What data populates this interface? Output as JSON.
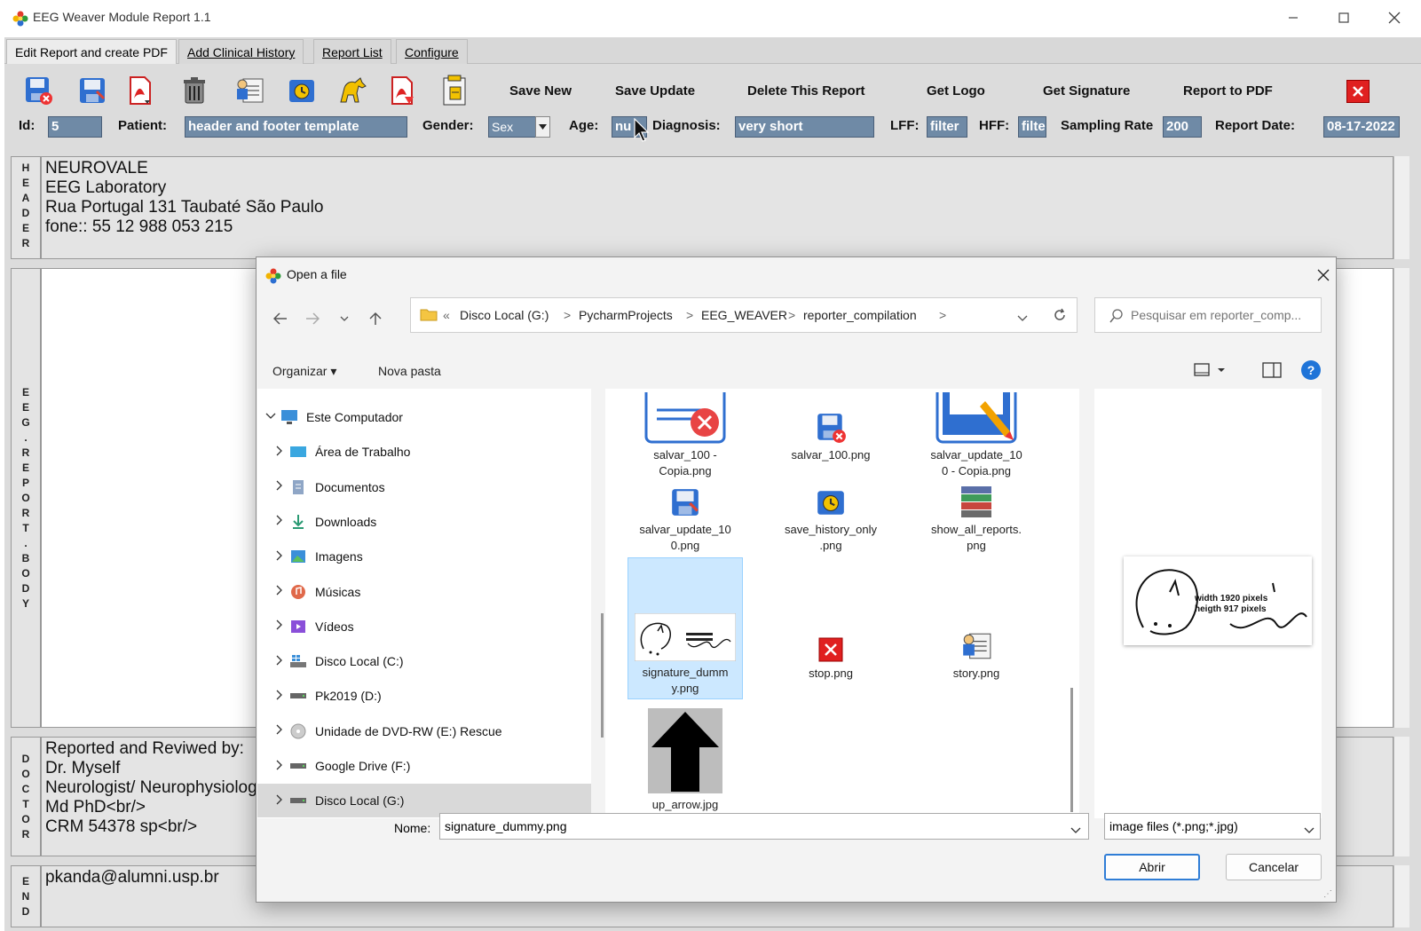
{
  "app": {
    "title": "EEG Weaver Module Report 1.1",
    "icon": "colorful-flower-icon"
  },
  "menu_tabs": [
    {
      "label": "Edit Report and create PDF",
      "active": true
    },
    {
      "label": "Add Clinical History",
      "active": false
    },
    {
      "label": "Report List",
      "active": false
    },
    {
      "label": "Configure",
      "active": false
    }
  ],
  "toolbar": {
    "icons": [
      "delete-save-icon",
      "save-icon",
      "pdf-icon",
      "trash-icon",
      "story-icon",
      "save-history-icon",
      "horse-logo-icon",
      "pdf-arrow-icon",
      "signature-file-icon"
    ],
    "labels": {
      "save_new": "Save New",
      "save_update": "Save Update",
      "delete_report": "Delete This Report",
      "get_logo": "Get Logo",
      "get_signature": "Get Signature",
      "report_to_pdf": "Report to PDF"
    }
  },
  "form": {
    "id_label": "Id:",
    "id_value": "5",
    "patient_label": "Patient:",
    "patient_value": "header and footer template",
    "gender_label": "Gender:",
    "gender_value": "Sex",
    "age_label": "Age:",
    "age_value": "nu",
    "diagnosis_label": "Diagnosis:",
    "diagnosis_value": "very short",
    "lff_label": "LFF:",
    "lff_value": "filter",
    "hff_label": "HFF:",
    "hff_value": "filte",
    "sampling_label": "Sampling Rate",
    "sampling_value": "200",
    "date_label": "Report Date:",
    "date_value": "08-17-2022"
  },
  "sections": {
    "header_letters": [
      "H",
      "E",
      "A",
      "D",
      "E",
      "R"
    ],
    "header_text": [
      "NEUROVALE",
      "EEG Laboratory",
      "Rua Portugal 131 Taubaté São Paulo",
      "fone::  55 12 988 053 215"
    ],
    "body_letters": [
      "E",
      "E",
      "G",
      ".",
      "R",
      "E",
      "P",
      "O",
      "R",
      "T",
      ".",
      "B",
      "O",
      "D",
      "Y"
    ],
    "doctor_letters": [
      "D",
      "O",
      "C",
      "T",
      "O",
      "R"
    ],
    "doctor_text": [
      "Reported and Reviwed by:",
      "Dr.  Myself",
      "Neurologist/ Neurophysiolog",
      "Md PhD<br/>",
      "CRM 54378 sp<br/>"
    ],
    "end_letters": [
      "E",
      "N",
      "D"
    ],
    "end_text": "pkanda@alumni.usp.br"
  },
  "dialog": {
    "title": "Open a file",
    "breadcrumb": [
      "«",
      "Disco Local (G:)",
      ">",
      "PycharmProjects",
      ">",
      "EEG_WEAVER",
      ">",
      "reporter_compilation",
      ">"
    ],
    "search_placeholder": "Pesquisar em reporter_comp...",
    "organize": "Organizar ▾",
    "new_folder": "Nova pasta",
    "tree": [
      {
        "label": "Este Computador",
        "icon": "computer-icon",
        "expanded": true,
        "indent": 0
      },
      {
        "label": "Área de Trabalho",
        "icon": "desktop-icon",
        "indent": 1
      },
      {
        "label": "Documentos",
        "icon": "documents-icon",
        "indent": 1
      },
      {
        "label": "Downloads",
        "icon": "download-icon",
        "indent": 1
      },
      {
        "label": "Imagens",
        "icon": "pictures-icon",
        "indent": 1
      },
      {
        "label": "Músicas",
        "icon": "music-icon",
        "indent": 1
      },
      {
        "label": "Vídeos",
        "icon": "videos-icon",
        "indent": 1
      },
      {
        "label": "Disco Local (C:)",
        "icon": "windows-drive-icon",
        "indent": 1
      },
      {
        "label": "Pk2019 (D:)",
        "icon": "drive-icon",
        "indent": 1
      },
      {
        "label": "Unidade de DVD-RW (E:) Rescue",
        "icon": "dvd-icon",
        "indent": 1
      },
      {
        "label": "Google Drive (F:)",
        "icon": "drive-icon",
        "indent": 1
      },
      {
        "label": "Disco Local (G:)",
        "icon": "drive-icon",
        "indent": 1,
        "selected": true
      }
    ],
    "files": [
      {
        "name": "salvar_100 - Copia.png",
        "lines": [
          "salvar_100 -",
          "Copia.png"
        ],
        "icon": "delete-save-icon"
      },
      {
        "name": "salvar_100.png",
        "lines": [
          "salvar_100.png"
        ],
        "icon": "delete-save-icon"
      },
      {
        "name": "salvar_update_100 - Copia.png",
        "lines": [
          "salvar_update_10",
          "0 - Copia.png"
        ],
        "icon": "edit-icon"
      },
      {
        "name": "salvar_update_100.png",
        "lines": [
          "salvar_update_10",
          "0.png"
        ],
        "icon": "save-icon"
      },
      {
        "name": "save_history_only.png",
        "lines": [
          "save_history_only",
          ".png"
        ],
        "icon": "save-history-icon"
      },
      {
        "name": "show_all_reports.png",
        "lines": [
          "show_all_reports.",
          "png"
        ],
        "icon": "stack-icon"
      },
      {
        "name": "signature_dummy.png",
        "lines": [
          "signature_dumm",
          "y.png"
        ],
        "icon": "signature-thumbnail-icon",
        "selected": true
      },
      {
        "name": "stop.png",
        "lines": [
          "stop.png"
        ],
        "icon": "stop-icon"
      },
      {
        "name": "story.png",
        "lines": [
          "story.png"
        ],
        "icon": "story-icon"
      },
      {
        "name": "up_arrow.jpg",
        "lines": [
          "up_arrow.jpg"
        ],
        "icon": "up-arrow-icon"
      }
    ],
    "preview_text": [
      "width 1920 pixels",
      "heigth 917 pixels"
    ],
    "filename_label": "Nome:",
    "filename_value": "signature_dummy.png",
    "filter_value": "image files (*.png;*.jpg)",
    "open_button": "Abrir",
    "cancel_button": "Cancelar"
  }
}
